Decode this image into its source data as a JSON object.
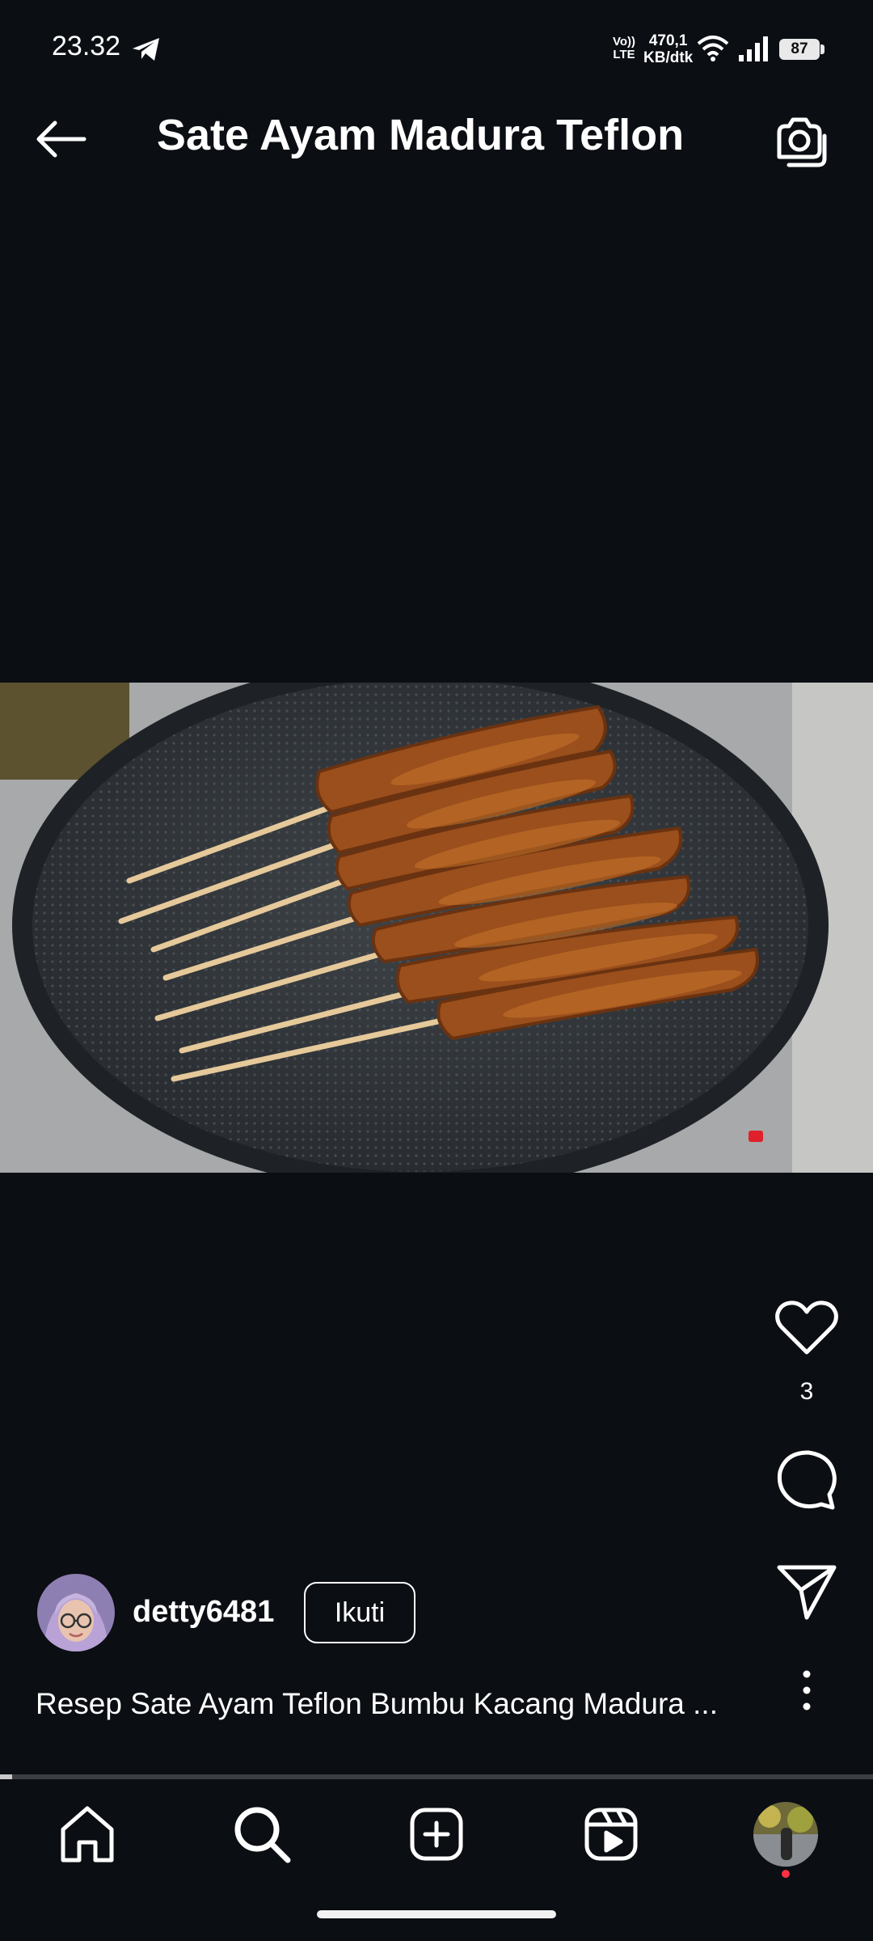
{
  "status_bar": {
    "time": "23.32",
    "volte_top": "Vo))",
    "volte_bottom": "LTE",
    "speed_value": "470,1",
    "speed_unit": "KB/dtk",
    "battery": "87",
    "icons": [
      "telegram-icon",
      "wifi-icon",
      "signal-icon"
    ]
  },
  "header": {
    "title": "Sate Ayam Madura Teflon",
    "back_icon": "arrow-left-icon",
    "camera_icon": "camera-icon"
  },
  "post": {
    "likes": "3",
    "username": "detty6481",
    "follow_label": "Ikuti",
    "caption": "Resep Sate Ayam Teflon Bumbu Kacang Madura ...",
    "progress": 0.014
  },
  "bottom_nav": {
    "items": [
      "home-icon",
      "search-icon",
      "create-icon",
      "reels-icon",
      "profile-avatar"
    ]
  },
  "colors": {
    "background": "#0b0e13",
    "text": "#ffffff",
    "notification_dot": "#ff3040"
  }
}
